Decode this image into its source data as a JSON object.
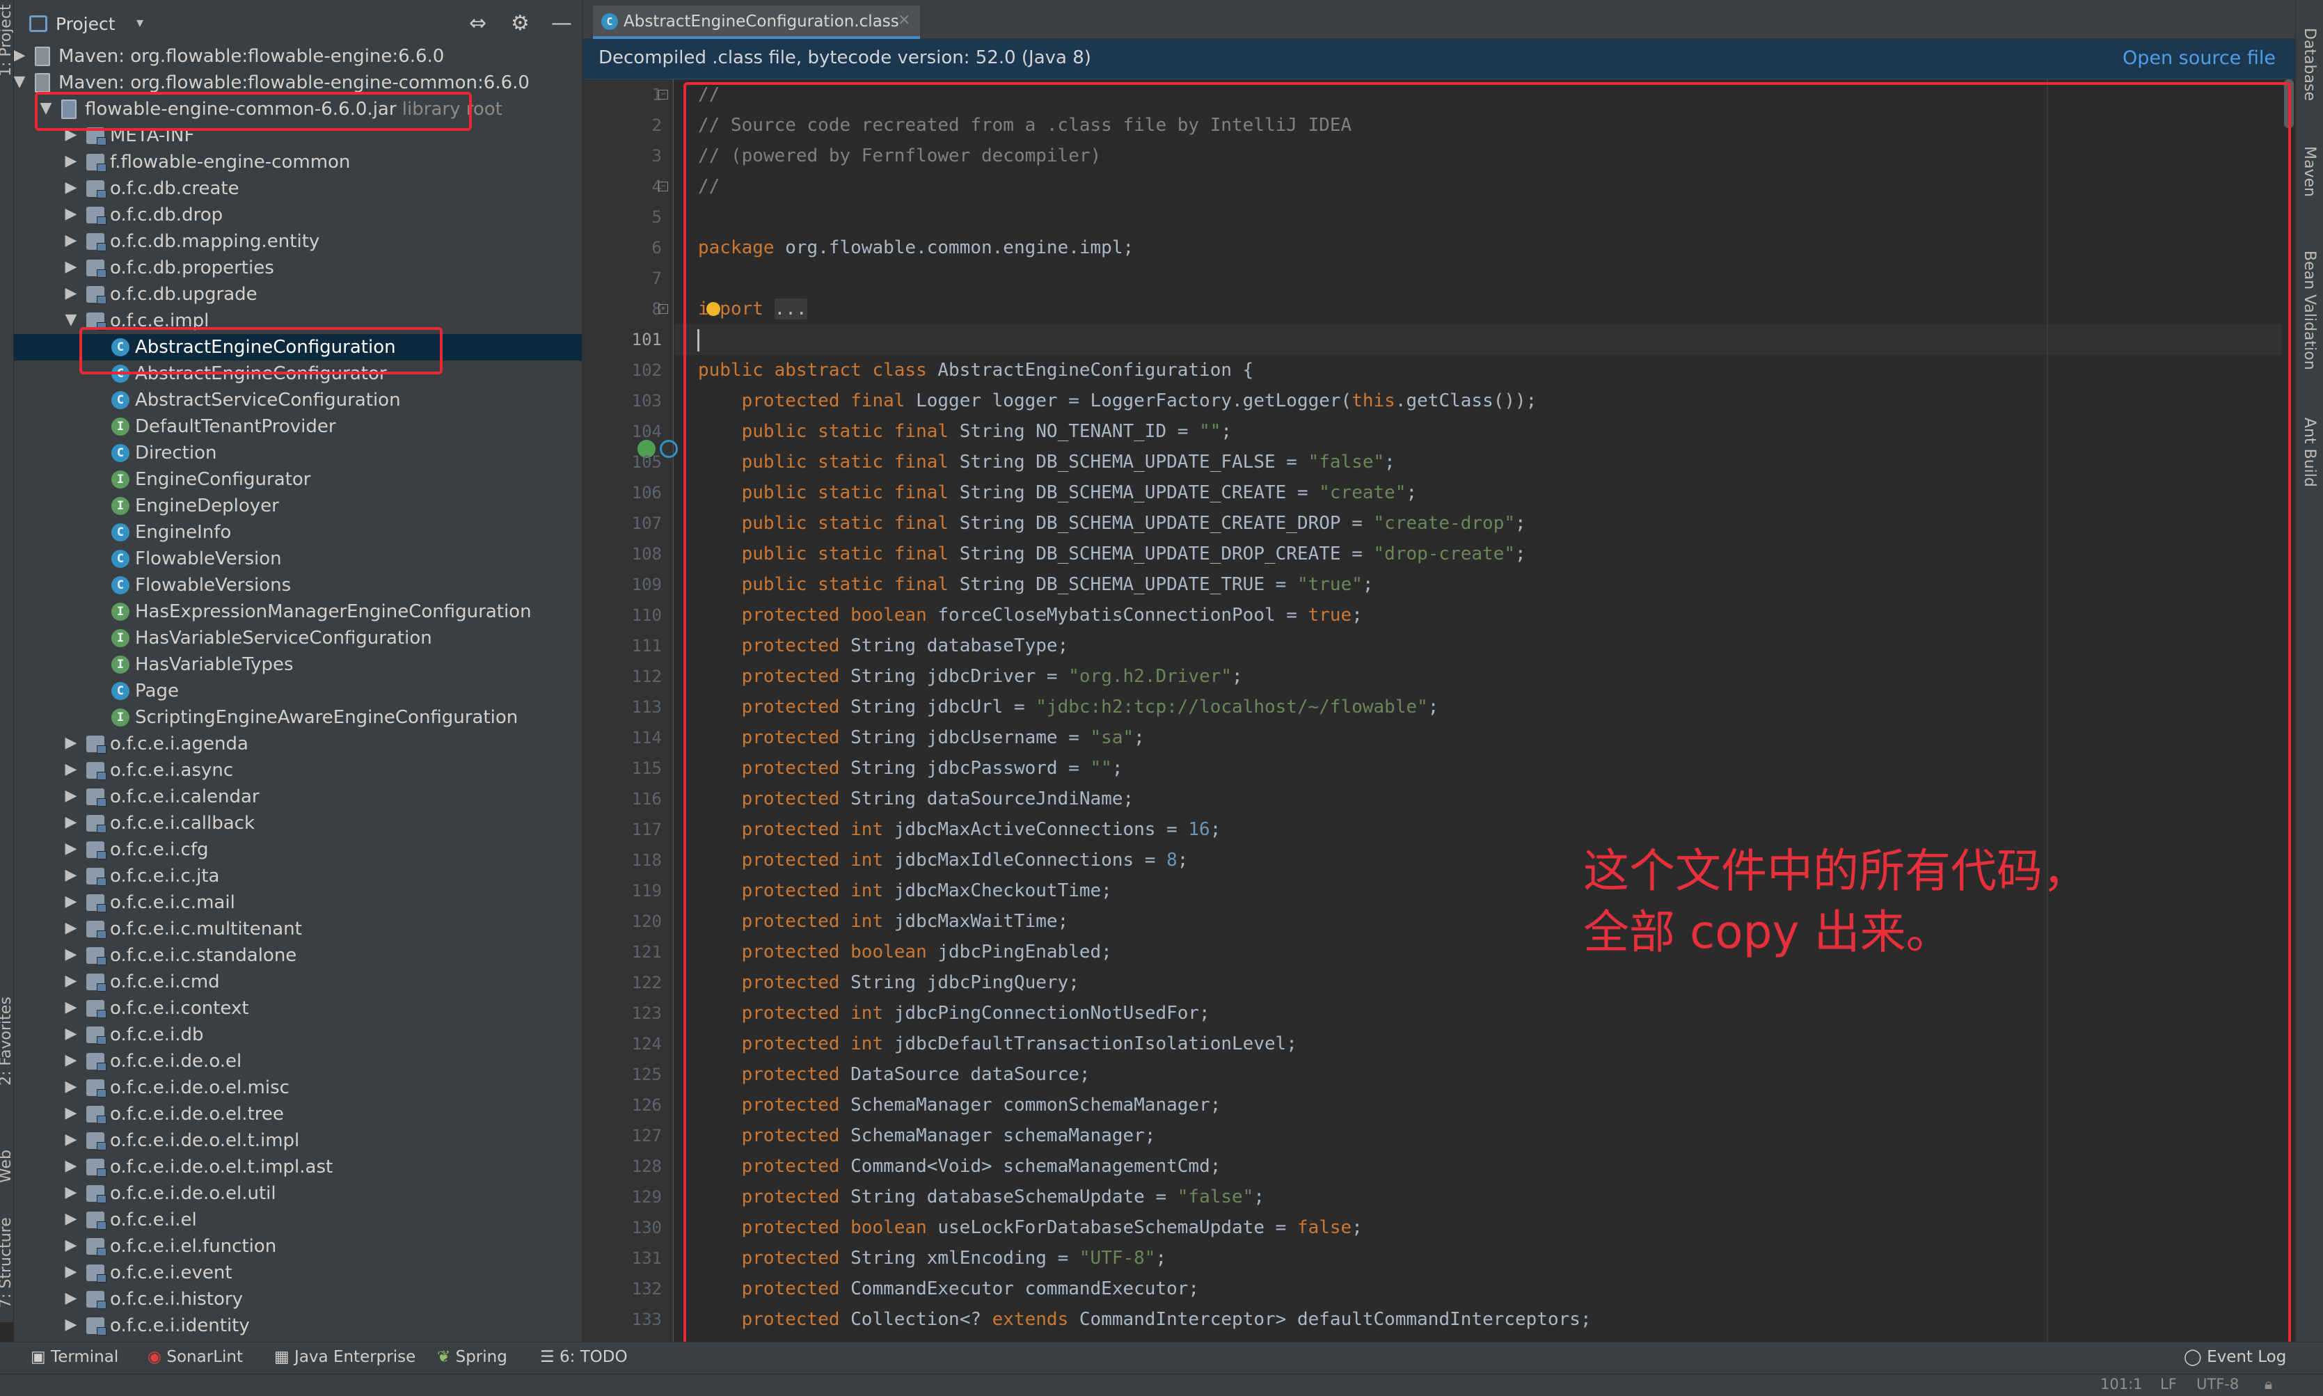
{
  "left_strip": {
    "project": "1: Project",
    "favorites": "2: Favorites",
    "web": "Web",
    "structure": "7: Structure"
  },
  "right_strip": {
    "database": "Database",
    "maven": "Maven",
    "bean_validation": "Bean Validation",
    "ant_build": "Ant Build"
  },
  "project_panel": {
    "title": "Project",
    "dropdown": "▾",
    "collapse_icon": "⇔",
    "gear_icon": "⚙",
    "hide_icon": "—",
    "maven1": "Maven: org.flowable:flowable-engine:6.6.0",
    "maven2": "Maven: org.flowable:flowable-engine-common:6.6.0",
    "jar": "flowable-engine-common-6.6.0.jar",
    "jar_suffix": "library root",
    "packages_top": [
      "META-INF",
      "f.flowable-engine-common",
      "o.f.c.db.create",
      "o.f.c.db.drop",
      "o.f.c.db.mapping.entity",
      "o.f.c.db.properties",
      "o.f.c.db.upgrade"
    ],
    "impl_package": "o.f.c.e.impl",
    "selected_class": "AbstractEngineConfiguration",
    "classes": [
      {
        "name": "AbstractEngineConfigurator",
        "kind": "C"
      },
      {
        "name": "AbstractServiceConfiguration",
        "kind": "C"
      },
      {
        "name": "DefaultTenantProvider",
        "kind": "I"
      },
      {
        "name": "Direction",
        "kind": "C"
      },
      {
        "name": "EngineConfigurator",
        "kind": "I"
      },
      {
        "name": "EngineDeployer",
        "kind": "I"
      },
      {
        "name": "EngineInfo",
        "kind": "C"
      },
      {
        "name": "FlowableVersion",
        "kind": "C"
      },
      {
        "name": "FlowableVersions",
        "kind": "C"
      },
      {
        "name": "HasExpressionManagerEngineConfiguration",
        "kind": "I"
      },
      {
        "name": "HasVariableServiceConfiguration",
        "kind": "I"
      },
      {
        "name": "HasVariableTypes",
        "kind": "I"
      },
      {
        "name": "Page",
        "kind": "C"
      },
      {
        "name": "ScriptingEngineAwareEngineConfiguration",
        "kind": "I"
      }
    ],
    "packages_bottom": [
      "o.f.c.e.i.agenda",
      "o.f.c.e.i.async",
      "o.f.c.e.i.calendar",
      "o.f.c.e.i.callback",
      "o.f.c.e.i.cfg",
      "o.f.c.e.i.c.jta",
      "o.f.c.e.i.c.mail",
      "o.f.c.e.i.c.multitenant",
      "o.f.c.e.i.c.standalone",
      "o.f.c.e.i.cmd",
      "o.f.c.e.i.context",
      "o.f.c.e.i.db",
      "o.f.c.e.i.de.o.el",
      "o.f.c.e.i.de.o.el.misc",
      "o.f.c.e.i.de.o.el.tree",
      "o.f.c.e.i.de.o.el.t.impl",
      "o.f.c.e.i.de.o.el.t.impl.ast",
      "o.f.c.e.i.de.o.el.util",
      "o.f.c.e.i.el",
      "o.f.c.e.i.el.function",
      "o.f.c.e.i.event",
      "o.f.c.e.i.history",
      "o.f.c.e.i.identity"
    ]
  },
  "editor": {
    "tab": "AbstractEngineConfiguration.class",
    "tab_close": "×",
    "banner_text": "Decompiled .class file, bytecode version: 52.0 (Java 8)",
    "banner_link": "Open source file",
    "lines": [
      {
        "n": "1",
        "t": [
          [
            "cm",
            "//"
          ]
        ]
      },
      {
        "n": "2",
        "t": [
          [
            "cm",
            "// Source code recreated from a .class file by IntelliJ IDEA"
          ]
        ]
      },
      {
        "n": "3",
        "t": [
          [
            "cm",
            "// (powered by Fernflower decompiler)"
          ]
        ]
      },
      {
        "n": "4",
        "t": [
          [
            "cm",
            "//"
          ]
        ]
      },
      {
        "n": "5",
        "t": []
      },
      {
        "n": "6",
        "t": [
          [
            "kw",
            "package "
          ],
          [
            "",
            "org.flowable.common.engine.impl;"
          ]
        ]
      },
      {
        "n": "7",
        "t": []
      },
      {
        "n": "8",
        "t": [
          [
            "kw",
            "import "
          ],
          [
            "fd",
            "..."
          ]
        ]
      },
      {
        "n": "101",
        "t": []
      },
      {
        "n": "102",
        "t": [
          [
            "kw",
            "public abstract class "
          ],
          [
            "",
            "AbstractEngineConfiguration {"
          ]
        ]
      },
      {
        "n": "103",
        "t": [
          [
            "kw",
            "    protected final "
          ],
          [
            "",
            "Logger logger = LoggerFactory.getLogger("
          ],
          [
            "kw",
            "this"
          ],
          [
            "",
            ".getClass());"
          ]
        ]
      },
      {
        "n": "104",
        "t": [
          [
            "kw",
            "    public static final "
          ],
          [
            "",
            "String NO_TENANT_ID = "
          ],
          [
            "st",
            "\"\""
          ],
          [
            "",
            ";"
          ]
        ]
      },
      {
        "n": "105",
        "t": [
          [
            "kw",
            "    public static final "
          ],
          [
            "",
            "String DB_SCHEMA_UPDATE_FALSE = "
          ],
          [
            "st",
            "\"false\""
          ],
          [
            "",
            ";"
          ]
        ]
      },
      {
        "n": "106",
        "t": [
          [
            "kw",
            "    public static final "
          ],
          [
            "",
            "String DB_SCHEMA_UPDATE_CREATE = "
          ],
          [
            "st",
            "\"create\""
          ],
          [
            "",
            ";"
          ]
        ]
      },
      {
        "n": "107",
        "t": [
          [
            "kw",
            "    public static final "
          ],
          [
            "",
            "String DB_SCHEMA_UPDATE_CREATE_DROP = "
          ],
          [
            "st",
            "\"create-drop\""
          ],
          [
            "",
            ";"
          ]
        ]
      },
      {
        "n": "108",
        "t": [
          [
            "kw",
            "    public static final "
          ],
          [
            "",
            "String DB_SCHEMA_UPDATE_DROP_CREATE = "
          ],
          [
            "st",
            "\"drop-create\""
          ],
          [
            "",
            ";"
          ]
        ]
      },
      {
        "n": "109",
        "t": [
          [
            "kw",
            "    public static final "
          ],
          [
            "",
            "String DB_SCHEMA_UPDATE_TRUE = "
          ],
          [
            "st",
            "\"true\""
          ],
          [
            "",
            ";"
          ]
        ]
      },
      {
        "n": "110",
        "t": [
          [
            "kw",
            "    protected boolean "
          ],
          [
            "",
            "forceCloseMybatisConnectionPool = "
          ],
          [
            "kw",
            "true"
          ],
          [
            "",
            ";"
          ]
        ]
      },
      {
        "n": "111",
        "t": [
          [
            "kw",
            "    protected "
          ],
          [
            "",
            "String databaseType;"
          ]
        ]
      },
      {
        "n": "112",
        "t": [
          [
            "kw",
            "    protected "
          ],
          [
            "",
            "String jdbcDriver = "
          ],
          [
            "st",
            "\"org.h2.Driver\""
          ],
          [
            "",
            ";"
          ]
        ]
      },
      {
        "n": "113",
        "t": [
          [
            "kw",
            "    protected "
          ],
          [
            "",
            "String jdbcUrl = "
          ],
          [
            "st",
            "\"jdbc:h2:tcp://localhost/~/flowable\""
          ],
          [
            "",
            ";"
          ]
        ]
      },
      {
        "n": "114",
        "t": [
          [
            "kw",
            "    protected "
          ],
          [
            "",
            "String jdbcUsername = "
          ],
          [
            "st",
            "\"sa\""
          ],
          [
            "",
            ";"
          ]
        ]
      },
      {
        "n": "115",
        "t": [
          [
            "kw",
            "    protected "
          ],
          [
            "",
            "String jdbcPassword = "
          ],
          [
            "st",
            "\"\""
          ],
          [
            "",
            ";"
          ]
        ]
      },
      {
        "n": "116",
        "t": [
          [
            "kw",
            "    protected "
          ],
          [
            "",
            "String dataSourceJndiName;"
          ]
        ]
      },
      {
        "n": "117",
        "t": [
          [
            "kw",
            "    protected int "
          ],
          [
            "",
            "jdbcMaxActiveConnections = "
          ],
          [
            "nm",
            "16"
          ],
          [
            "",
            ";"
          ]
        ]
      },
      {
        "n": "118",
        "t": [
          [
            "kw",
            "    protected int "
          ],
          [
            "",
            "jdbcMaxIdleConnections = "
          ],
          [
            "nm",
            "8"
          ],
          [
            "",
            ";"
          ]
        ]
      },
      {
        "n": "119",
        "t": [
          [
            "kw",
            "    protected int "
          ],
          [
            "",
            "jdbcMaxCheckoutTime;"
          ]
        ]
      },
      {
        "n": "120",
        "t": [
          [
            "kw",
            "    protected int "
          ],
          [
            "",
            "jdbcMaxWaitTime;"
          ]
        ]
      },
      {
        "n": "121",
        "t": [
          [
            "kw",
            "    protected boolean "
          ],
          [
            "",
            "jdbcPingEnabled;"
          ]
        ]
      },
      {
        "n": "122",
        "t": [
          [
            "kw",
            "    protected "
          ],
          [
            "",
            "String jdbcPingQuery;"
          ]
        ]
      },
      {
        "n": "123",
        "t": [
          [
            "kw",
            "    protected int "
          ],
          [
            "",
            "jdbcPingConnectionNotUsedFor;"
          ]
        ]
      },
      {
        "n": "124",
        "t": [
          [
            "kw",
            "    protected int "
          ],
          [
            "",
            "jdbcDefaultTransactionIsolationLevel;"
          ]
        ]
      },
      {
        "n": "125",
        "t": [
          [
            "kw",
            "    protected "
          ],
          [
            "",
            "DataSource dataSource;"
          ]
        ]
      },
      {
        "n": "126",
        "t": [
          [
            "kw",
            "    protected "
          ],
          [
            "",
            "SchemaManager commonSchemaManager;"
          ]
        ]
      },
      {
        "n": "127",
        "t": [
          [
            "kw",
            "    protected "
          ],
          [
            "",
            "SchemaManager schemaManager;"
          ]
        ]
      },
      {
        "n": "128",
        "t": [
          [
            "kw",
            "    protected "
          ],
          [
            "",
            "Command<Void> schemaManagementCmd;"
          ]
        ]
      },
      {
        "n": "129",
        "t": [
          [
            "kw",
            "    protected "
          ],
          [
            "",
            "String databaseSchemaUpdate = "
          ],
          [
            "st",
            "\"false\""
          ],
          [
            "",
            ";"
          ]
        ]
      },
      {
        "n": "130",
        "t": [
          [
            "kw",
            "    protected boolean "
          ],
          [
            "",
            "useLockForDatabaseSchemaUpdate = "
          ],
          [
            "kw",
            "false"
          ],
          [
            "",
            ";"
          ]
        ]
      },
      {
        "n": "131",
        "t": [
          [
            "kw",
            "    protected "
          ],
          [
            "",
            "String xmlEncoding = "
          ],
          [
            "st",
            "\"UTF-8\""
          ],
          [
            "",
            ";"
          ]
        ]
      },
      {
        "n": "132",
        "t": [
          [
            "kw",
            "    protected "
          ],
          [
            "",
            "CommandExecutor commandExecutor;"
          ]
        ]
      },
      {
        "n": "133",
        "t": [
          [
            "kw",
            "    protected "
          ],
          [
            "",
            "Collection<? "
          ],
          [
            "kw",
            "extends "
          ],
          [
            "",
            "CommandInterceptor> defaultCommandInterceptors;"
          ]
        ]
      }
    ]
  },
  "annotation": {
    "note": "这个文件中的所有代码，\n全部 copy 出来。"
  },
  "bottom_bar": {
    "terminal": "Terminal",
    "sonarlint": "SonarLint",
    "java_enterprise": "Java Enterprise",
    "spring": "Spring",
    "todo": "6: TODO",
    "event_log": "Event Log"
  },
  "status_bar": {
    "position": "101:1",
    "line_sep": "LF",
    "encoding": "UTF-8"
  },
  "colors": {
    "keyword": "#cc7832",
    "string": "#6a8759",
    "comment": "#808080",
    "number": "#6897bb",
    "annotation_red": "#e82a36",
    "link": "#4f9fe8"
  }
}
